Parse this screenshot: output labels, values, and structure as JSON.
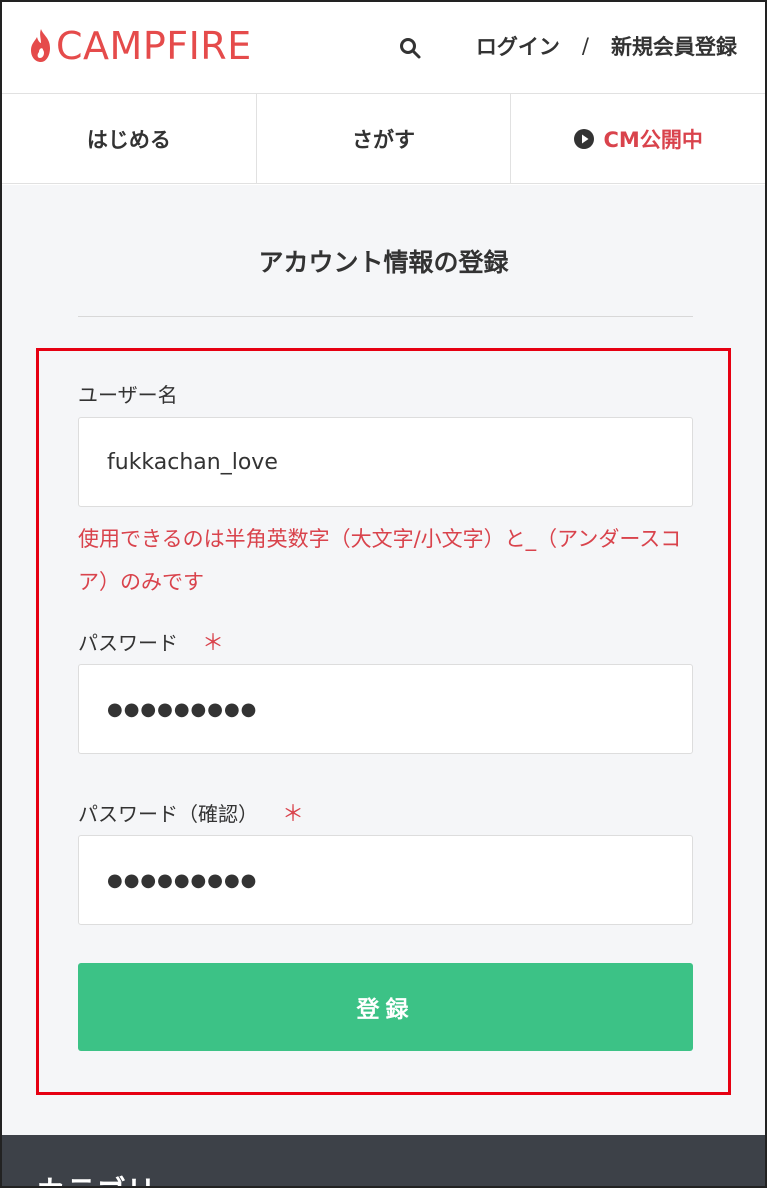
{
  "header": {
    "logo_text": "CAMPFIRE",
    "login_label": "ログイン",
    "separator": "/",
    "register_label": "新規会員登録",
    "brand_color": "#e54b4b"
  },
  "tabs": [
    {
      "label": "はじめる"
    },
    {
      "label": "さがす"
    },
    {
      "label": "CM公開中",
      "icon": "play-circle-icon"
    }
  ],
  "main": {
    "title": "アカウント情報の登録",
    "username": {
      "label": "ユーザー名",
      "value": "fukkachan_love",
      "error": "使用できるのは半角英数字（大文字/小文字）と_（アンダースコア）のみです"
    },
    "password": {
      "label": "パスワード",
      "required_mark": "＊",
      "value": "●●●●●●●●●"
    },
    "password_confirm": {
      "label": "パスワード（確認）",
      "required_mark": "＊",
      "value": "●●●●●●●●●"
    },
    "submit_label": "登録",
    "submit_color": "#3cc286",
    "error_color": "#d9434c"
  },
  "footer": {
    "title_partial": "カテゴリー"
  }
}
